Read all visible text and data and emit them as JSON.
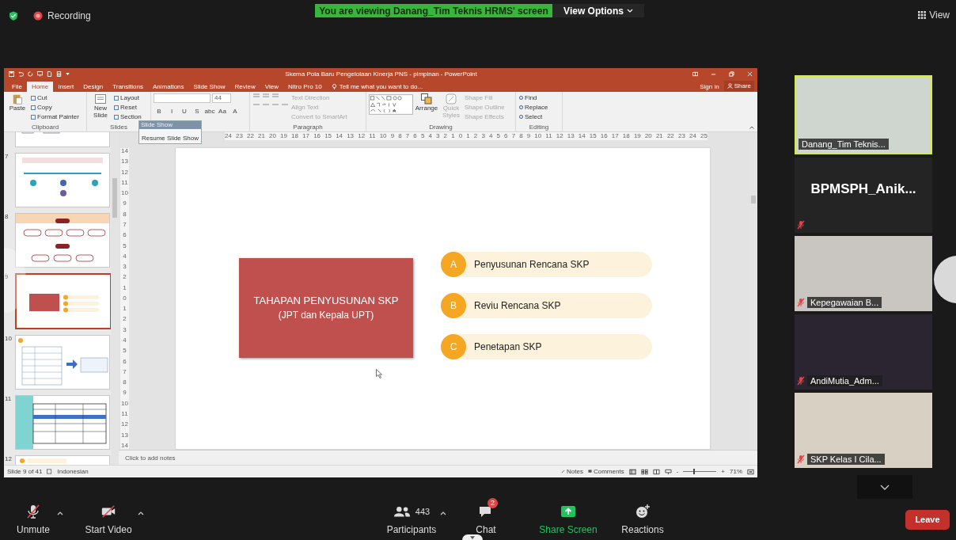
{
  "meeting": {
    "recording_label": "Recording",
    "banner": "You are viewing Danang_Tim Teknis HRMS' screen",
    "view_options": "View Options",
    "view_label": "View"
  },
  "powerpoint": {
    "title": "Skema Pola Baru Pengelolaan Kinerja PNS - pimpinan - PowerPoint",
    "tabs": [
      {
        "label": "File",
        "selected": false
      },
      {
        "label": "Home",
        "selected": true
      },
      {
        "label": "Insert",
        "selected": false
      },
      {
        "label": "Design",
        "selected": false
      },
      {
        "label": "Transitions",
        "selected": false
      },
      {
        "label": "Animations",
        "selected": false
      },
      {
        "label": "Slide Show",
        "selected": false
      },
      {
        "label": "Review",
        "selected": false
      },
      {
        "label": "View",
        "selected": false
      },
      {
        "label": "Nitro Pro 10",
        "selected": false
      }
    ],
    "tell_me": "Tell me what you want to do...",
    "sign_in": "Sign in",
    "share": "Share",
    "ribbon": {
      "clipboard": {
        "label": "Clipboard",
        "paste": "Paste",
        "items": [
          "Cut",
          "Copy",
          "Format Painter"
        ]
      },
      "slides": {
        "label": "Slides",
        "new_slide": "New Slide",
        "items": [
          "Layout",
          "Reset",
          "Section"
        ]
      },
      "font": {
        "size": "44",
        "buttons": [
          "B",
          "I",
          "U",
          "S",
          "abc",
          "Aa",
          "A"
        ]
      },
      "paragraph": {
        "label": "Paragraph",
        "items": [
          {
            "label": "Text Direction",
            "disabled": true
          },
          {
            "label": "Align Text",
            "disabled": true
          },
          {
            "label": "Convert to SmartArt",
            "disabled": true
          }
        ]
      },
      "drawing": {
        "label": "Drawing",
        "arrange": "Arrange",
        "quick_styles": "Quick Styles",
        "items": [
          {
            "label": "Shape Fill",
            "disabled": true
          },
          {
            "label": "Shape Outline",
            "disabled": true
          },
          {
            "label": "Shape Effects",
            "disabled": true
          }
        ]
      },
      "editing": {
        "label": "Editing",
        "items": [
          "Find",
          "Replace",
          "Select"
        ]
      }
    },
    "slideshow_popup": {
      "title": "Slide Show",
      "resume": "Resume Slide Show"
    },
    "horizontal_ruler": [
      "24",
      "23",
      "22",
      "21",
      "20",
      "19",
      "18",
      "17",
      "16",
      "15",
      "14",
      "13",
      "12",
      "11",
      "10",
      "9",
      "8",
      "7",
      "6",
      "5",
      "4",
      "3",
      "2",
      "1",
      "0",
      "1",
      "2",
      "3",
      "4",
      "5",
      "6",
      "7",
      "8",
      "9",
      "10",
      "11",
      "12",
      "13",
      "14",
      "15",
      "16",
      "17",
      "18",
      "19",
      "20",
      "21",
      "22",
      "23",
      "24",
      "25"
    ],
    "vertical_ruler": [
      "14",
      "13",
      "12",
      "11",
      "10",
      "9",
      "8",
      "7",
      "6",
      "5",
      "4",
      "3",
      "2",
      "1",
      "0",
      "1",
      "2",
      "3",
      "4",
      "5",
      "6",
      "7",
      "8",
      "9",
      "10",
      "11",
      "12",
      "13",
      "14"
    ],
    "thumbnails": [
      {
        "kind": "flow",
        "selected": false
      },
      {
        "number": "7",
        "kind": "timeline",
        "selected": false
      },
      {
        "number": "8",
        "kind": "org",
        "selected": false
      },
      {
        "number": "9",
        "kind": "agenda",
        "selected": true
      },
      {
        "number": "10",
        "kind": "form",
        "selected": false
      },
      {
        "number": "11",
        "kind": "table",
        "selected": false
      },
      {
        "number": "12",
        "kind": "header",
        "selected": false
      }
    ],
    "slide": {
      "title": "TAHAPAN PENYUSUNAN SKP",
      "subtitle": "(JPT dan Kepala UPT)",
      "steps": [
        {
          "letter": "A",
          "text": "Penyusunan Rencana SKP"
        },
        {
          "letter": "B",
          "text": "Reviu Rencana SKP"
        },
        {
          "letter": "C",
          "text": "Penetapan SKP"
        }
      ]
    },
    "notes_placeholder": "Click to add notes",
    "status": {
      "slide_count": "Slide 9 of 41",
      "language": "Indonesian",
      "notes": "Notes",
      "comments": "Comments",
      "zoom_minus": "-",
      "zoom_plus": "+",
      "zoom_level": "71%",
      "level": 0.3
    }
  },
  "participants": [
    {
      "name": "Danang_Tim Teknis...",
      "kind": "video",
      "muted": false,
      "speaking": true
    },
    {
      "name": "BPMSPH_Anik...",
      "kind": "name_only",
      "muted": true,
      "speaking": false
    },
    {
      "name": "Kepegawaian B...",
      "kind": "video",
      "muted": true,
      "speaking": false
    },
    {
      "name": "AndiMutia_Adm...",
      "kind": "video",
      "muted": true,
      "speaking": false
    },
    {
      "name": "SKP Kelas I Cila...",
      "kind": "video",
      "muted": true,
      "speaking": false
    }
  ],
  "toolbar": {
    "unmute": "Unmute",
    "start_video": "Start Video",
    "participants": "Participants",
    "participant_count": "443",
    "chat": "Chat",
    "chat_badge": "2",
    "share_screen": "Share Screen",
    "reactions": "Reactions",
    "leave": "Leave"
  }
}
